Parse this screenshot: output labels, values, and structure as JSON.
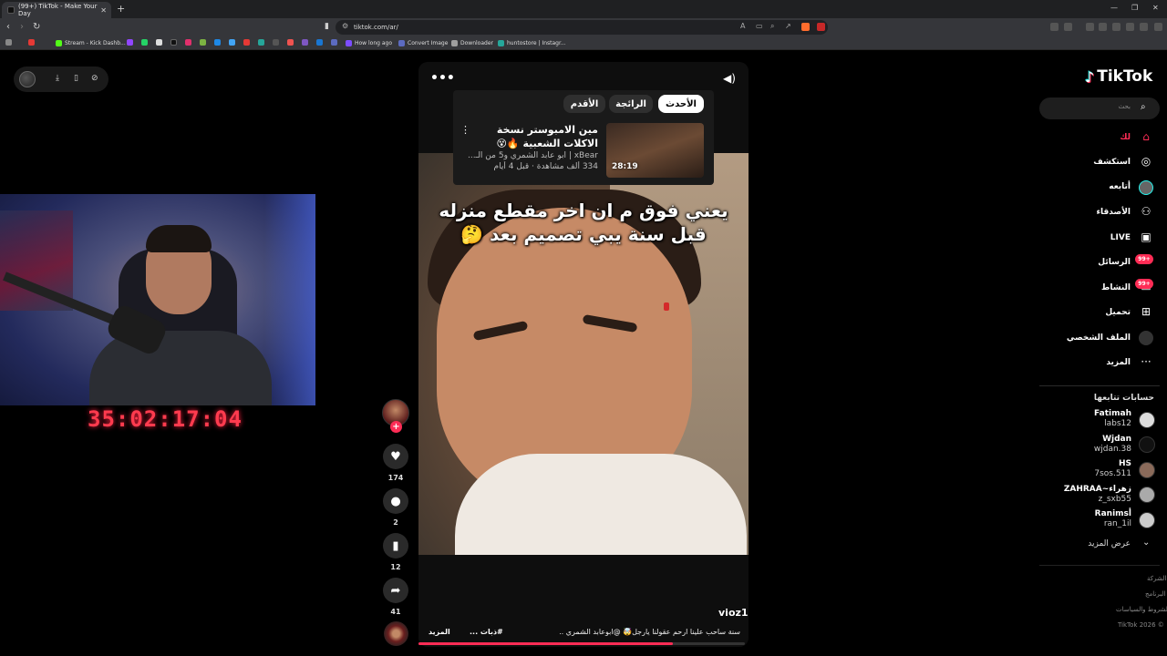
{
  "browser": {
    "tab_title": "(99+) TikTok - Make Your Day",
    "tab_close": "✕",
    "new_tab": "+",
    "url": "tiktok.com/ar/",
    "bookmarks": [
      {
        "label": "Stream - Kick Dashb...",
        "color": "#53fc18"
      },
      {
        "label": "How long ago",
        "color": "#7c4dff"
      },
      {
        "label": "Convert Image",
        "color": "#5c6bc0"
      },
      {
        "label": "Downloader",
        "color": "#9e9e9e"
      },
      {
        "label": "huntostore | Instagr...",
        "color": "#26a69a"
      }
    ]
  },
  "stream": {
    "timer": "35:02:17:04"
  },
  "video": {
    "caption": "يعني فوق م ان اخر مقطع منزله قبل سنة يبي تصميم بعد 🤔",
    "author": "vioz1",
    "description": "سنة ساحب علينا ارحم عقولنا يارجل🤯 @ابوعابد الشمري ..",
    "hashtag": "#ذبات ...",
    "more": "المزيد",
    "progress": 0.78,
    "related": {
      "tabs": [
        "الأحدث",
        "الرائجة",
        "الأقدم"
      ],
      "title": "مين الامبوستر نسخة الاكلات الشعبية 🔥😵",
      "channel": "xBear | ابو عابد الشمري و5 من الـ...",
      "stats": "334 ألف مشاهدة · قبل 4 أيام",
      "duration": "28:19"
    }
  },
  "actions": {
    "likes": "174",
    "comments": "2",
    "saves": "12",
    "shares": "41"
  },
  "sidebar": {
    "logo": "TikTok",
    "search_placeholder": "بحث",
    "nav": [
      {
        "label": "لك",
        "icon": "home-icon"
      },
      {
        "label": "استكشف",
        "icon": "compass-icon"
      },
      {
        "label": "أتابعه",
        "icon": "following-icon"
      },
      {
        "label": "الأصدقاء",
        "icon": "friends-icon"
      },
      {
        "label": "LIVE",
        "icon": "live-icon"
      },
      {
        "label": "الرسائل",
        "icon": "messages-icon",
        "badge": "99+"
      },
      {
        "label": "النشاط",
        "icon": "activity-icon",
        "badge": "99+"
      },
      {
        "label": "تحميل",
        "icon": "upload-icon"
      },
      {
        "label": "الملف الشخصي",
        "icon": "profile-icon"
      },
      {
        "label": "المزيد",
        "icon": "more-icon"
      }
    ],
    "following_title": "حسابات تتابعها",
    "accounts": [
      {
        "name": "Fatimah",
        "user": "labs12"
      },
      {
        "name": "Wjdan",
        "user": "wjdan.38"
      },
      {
        "name": "HS",
        "user": "7sos.511"
      },
      {
        "name": "ZAHRAA~زهراء",
        "user": "z_sxb55"
      },
      {
        "name": "Ranimsأ",
        "user": "ran_1il"
      }
    ],
    "see_more": "عرض المزيد",
    "footer": [
      "الشركة",
      "البرنامج",
      "الشروط والسياسات",
      "TikTok 2026 ©"
    ]
  },
  "colors": {
    "accent": "#fe2c55",
    "timer": "#ff3b4e"
  }
}
